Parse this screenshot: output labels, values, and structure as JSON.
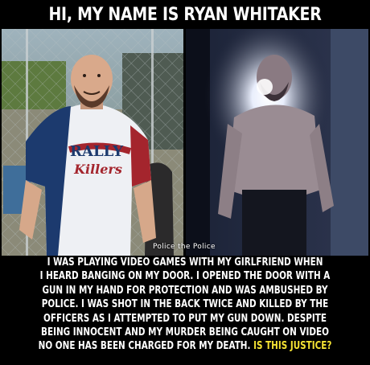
{
  "headline": "HI, MY NAME IS RYAN WHITAKER",
  "watermark": "Police the Police",
  "shirt_text": "RALLY Killers",
  "body_lines": [
    "I WAS PLAYING VIDEO GAMES WITH MY GIRLFRIEND WHEN",
    "I HEARD BANGING ON MY DOOR. I OPENED THE DOOR WITH A",
    "GUN IN MY HAND FOR PROTECTION AND WAS AMBUSHED BY",
    "POLICE. I WAS SHOT IN THE BACK TWICE AND KILLED BY THE",
    "OFFICERS AS I ATTEMPTED TO PUT MY GUN DOWN. DESPITE",
    "BEING INNOCENT AND MY MURDER BEING CAUGHT ON VIDEO",
    "NO ONE HAS BEEN CHARGED FOR MY DEATH."
  ],
  "highlight": "IS THIS JUSTICE?",
  "colors": {
    "background": "#000000",
    "text": "#ffffff",
    "highlight": "#f4e233"
  }
}
